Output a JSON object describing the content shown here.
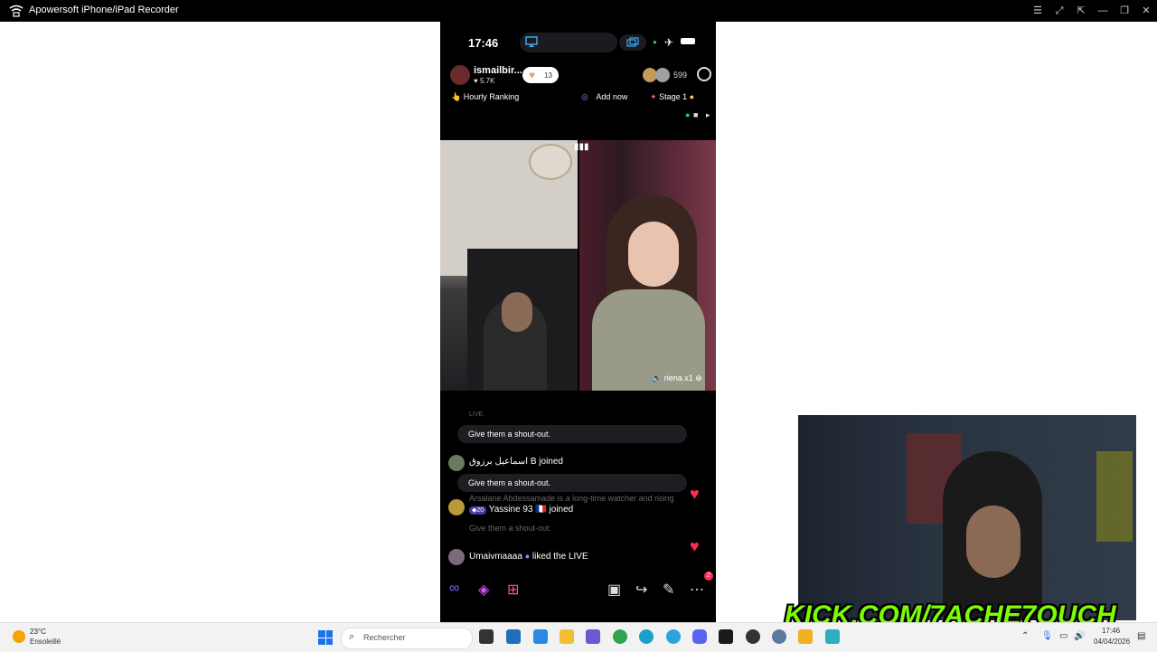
{
  "window": {
    "title": "Apowersoft iPhone/iPad Recorder",
    "controls": [
      "list",
      "expand",
      "pin",
      "minimize",
      "restore",
      "close"
    ]
  },
  "phone": {
    "status_time": "17:46",
    "host": {
      "name": "ismailbir...",
      "likes": "♥ 5.7K",
      "follow_count": "13"
    },
    "viewer_count": "599",
    "row2": {
      "ranking": "Hourly Ranking",
      "add_now": "Add now",
      "stage": "Stage 1"
    },
    "guest_name": "riena.x1",
    "chat": [
      {
        "type": "pill",
        "text": "Give them a shout-out."
      },
      {
        "type": "line",
        "user": "اسماعيل برزوق B",
        "action": "joined"
      },
      {
        "type": "pill",
        "text": "Give them a shout-out."
      },
      {
        "type": "line_faded",
        "text": "Arsalane Abdessamade is a long-time watcher and rising"
      },
      {
        "type": "line",
        "level": "20",
        "user": "Yassine 93 🇫🇷",
        "action": "joined"
      },
      {
        "type": "pill_faded",
        "text": "Give them a shout-out."
      },
      {
        "type": "line",
        "user": "Umaivmaaaa",
        "action": "liked the LIVE"
      }
    ],
    "notification_badge": "2"
  },
  "overlay_text": "KICK.COM/7ACHE7OUCH",
  "taskbar": {
    "weather": {
      "temp": "23°C",
      "condition": "Ensoleillé"
    },
    "search_placeholder": "Rechercher",
    "clock": {
      "time": "17:46",
      "date": "04/04/2026"
    }
  },
  "colors": {
    "like_heart": "#ff2d55",
    "kick_green": "#7cfc00",
    "accent_purple": "#8a5cff"
  }
}
